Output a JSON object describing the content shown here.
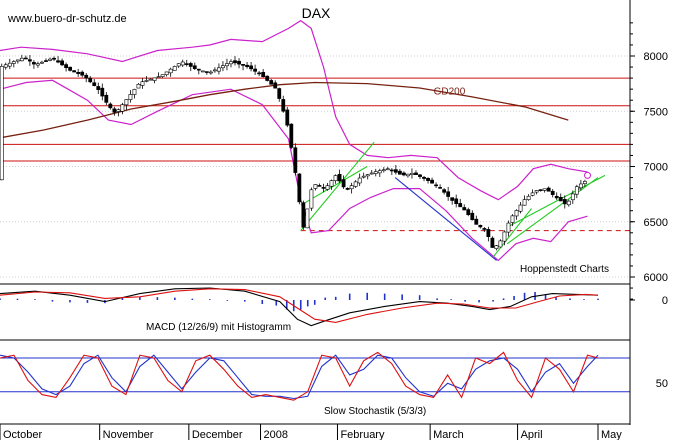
{
  "chart_data": [
    {
      "type": "candlestick",
      "panel": "price",
      "title": "DAX",
      "source_label": "www.buero-dr-schutz.de",
      "credit": "Hoppenstedt Charts",
      "y_ticks": [
        6000,
        6500,
        7000,
        7500,
        8000
      ],
      "ylim": [
        5800,
        8300
      ],
      "x_ticks": [
        "October",
        "November",
        "December",
        "2008",
        "February",
        "March",
        "April",
        "May"
      ],
      "moving_average": {
        "name": "GD200",
        "points": [
          [
            0,
            7260
          ],
          [
            25,
            7330
          ],
          [
            50,
            7420
          ],
          [
            75,
            7520
          ],
          [
            100,
            7590
          ],
          [
            120,
            7650
          ],
          [
            140,
            7700
          ],
          [
            160,
            7740
          ],
          [
            180,
            7760
          ],
          [
            210,
            7750
          ],
          [
            240,
            7710
          ],
          [
            270,
            7630
          ],
          [
            300,
            7540
          ],
          [
            325,
            7420
          ]
        ]
      },
      "price_path": [
        [
          0,
          7900
        ],
        [
          8,
          7950
        ],
        [
          14,
          7990
        ],
        [
          20,
          7920
        ],
        [
          30,
          7980
        ],
        [
          40,
          7870
        ],
        [
          48,
          7820
        ],
        [
          56,
          7700
        ],
        [
          62,
          7550
        ],
        [
          66,
          7480
        ],
        [
          70,
          7560
        ],
        [
          80,
          7760
        ],
        [
          92,
          7820
        ],
        [
          104,
          7950
        ],
        [
          112,
          7880
        ],
        [
          120,
          7850
        ],
        [
          132,
          7950
        ],
        [
          142,
          7900
        ],
        [
          150,
          7820
        ],
        [
          158,
          7700
        ],
        [
          164,
          7400
        ],
        [
          168,
          7050
        ],
        [
          171,
          6700
        ],
        [
          174,
          6400
        ],
        [
          177,
          6760
        ],
        [
          180,
          6840
        ],
        [
          186,
          6800
        ],
        [
          192,
          6920
        ],
        [
          198,
          6780
        ],
        [
          206,
          6900
        ],
        [
          214,
          6950
        ],
        [
          222,
          6980
        ],
        [
          230,
          6920
        ],
        [
          236,
          6940
        ],
        [
          244,
          6880
        ],
        [
          252,
          6800
        ],
        [
          258,
          6700
        ],
        [
          266,
          6600
        ],
        [
          272,
          6480
        ],
        [
          278,
          6420
        ],
        [
          282,
          6250
        ],
        [
          286,
          6320
        ],
        [
          292,
          6530
        ],
        [
          300,
          6700
        ],
        [
          306,
          6780
        ],
        [
          312,
          6800
        ],
        [
          318,
          6720
        ],
        [
          324,
          6650
        ],
        [
          330,
          6820
        ],
        [
          336,
          6880
        ]
      ],
      "upper_band": [
        [
          0,
          8050
        ],
        [
          12,
          8080
        ],
        [
          30,
          8060
        ],
        [
          50,
          8020
        ],
        [
          70,
          7950
        ],
        [
          90,
          8050
        ],
        [
          110,
          8080
        ],
        [
          120,
          8100
        ],
        [
          132,
          8150
        ],
        [
          150,
          8130
        ],
        [
          165,
          8250
        ],
        [
          172,
          8320
        ],
        [
          178,
          8250
        ],
        [
          185,
          7900
        ],
        [
          192,
          7450
        ],
        [
          200,
          7200
        ],
        [
          210,
          7100
        ],
        [
          222,
          7080
        ],
        [
          235,
          7100
        ],
        [
          250,
          7080
        ],
        [
          262,
          6900
        ],
        [
          275,
          6780
        ],
        [
          285,
          6700
        ],
        [
          296,
          6820
        ],
        [
          305,
          6980
        ],
        [
          315,
          7020
        ],
        [
          325,
          6980
        ],
        [
          336,
          6950
        ]
      ],
      "lower_band": [
        [
          0,
          7700
        ],
        [
          15,
          7760
        ],
        [
          30,
          7780
        ],
        [
          50,
          7600
        ],
        [
          62,
          7420
        ],
        [
          75,
          7380
        ],
        [
          90,
          7500
        ],
        [
          110,
          7650
        ],
        [
          132,
          7700
        ],
        [
          150,
          7560
        ],
        [
          165,
          7250
        ],
        [
          172,
          6700
        ],
        [
          178,
          6400
        ],
        [
          188,
          6420
        ],
        [
          200,
          6620
        ],
        [
          212,
          6720
        ],
        [
          225,
          6800
        ],
        [
          240,
          6800
        ],
        [
          255,
          6600
        ],
        [
          270,
          6350
        ],
        [
          285,
          6150
        ],
        [
          295,
          6300
        ],
        [
          305,
          6350
        ],
        [
          315,
          6320
        ],
        [
          325,
          6500
        ],
        [
          336,
          6550
        ]
      ],
      "horizontal_levels": [
        7800,
        7550,
        7200,
        7050
      ],
      "dashed_level": 6420,
      "trend_lines": [
        {
          "color": "#22cc22",
          "points": [
            [
              172,
              6420
            ],
            [
              214,
              7220
            ]
          ]
        },
        {
          "color": "#22cc22",
          "points": [
            [
              172,
              6650
            ],
            [
              210,
              7000
            ]
          ]
        },
        {
          "color": "#2233cc",
          "points": [
            [
              226,
              6900
            ],
            [
              284,
              6150
            ]
          ]
        },
        {
          "color": "#22cc22",
          "points": [
            [
              282,
              6180
            ],
            [
              304,
              6620
            ]
          ]
        },
        {
          "color": "#22cc22",
          "points": [
            [
              290,
              6300
            ],
            [
              342,
              6900
            ]
          ]
        },
        {
          "color": "#22cc22",
          "points": [
            [
              290,
              6450
            ],
            [
              346,
              6920
            ]
          ]
        }
      ]
    },
    {
      "type": "line",
      "panel": "macd",
      "label": "MACD (12/26/9) mit Histogramm",
      "y_ticks": [
        0
      ],
      "ylim": [
        -200,
        120
      ],
      "macd_line": [
        [
          0,
          40
        ],
        [
          20,
          55
        ],
        [
          40,
          30
        ],
        [
          60,
          -10
        ],
        [
          80,
          40
        ],
        [
          100,
          70
        ],
        [
          120,
          75
        ],
        [
          140,
          55
        ],
        [
          160,
          -10
        ],
        [
          170,
          -120
        ],
        [
          178,
          -160
        ],
        [
          186,
          -130
        ],
        [
          200,
          -80
        ],
        [
          220,
          -40
        ],
        [
          240,
          -10
        ],
        [
          256,
          -20
        ],
        [
          270,
          -40
        ],
        [
          280,
          -60
        ],
        [
          292,
          -40
        ],
        [
          304,
          20
        ],
        [
          316,
          40
        ],
        [
          330,
          35
        ],
        [
          342,
          30
        ]
      ],
      "signal_line": [
        [
          0,
          30
        ],
        [
          20,
          50
        ],
        [
          40,
          45
        ],
        [
          60,
          10
        ],
        [
          80,
          20
        ],
        [
          100,
          55
        ],
        [
          120,
          70
        ],
        [
          140,
          65
        ],
        [
          160,
          20
        ],
        [
          170,
          -50
        ],
        [
          180,
          -120
        ],
        [
          192,
          -140
        ],
        [
          210,
          -90
        ],
        [
          230,
          -50
        ],
        [
          250,
          -20
        ],
        [
          265,
          -25
        ],
        [
          280,
          -50
        ],
        [
          295,
          -50
        ],
        [
          308,
          -10
        ],
        [
          320,
          25
        ],
        [
          335,
          35
        ],
        [
          342,
          30
        ]
      ],
      "histogram": [
        [
          0,
          10
        ],
        [
          10,
          8
        ],
        [
          20,
          5
        ],
        [
          30,
          -10
        ],
        [
          40,
          -15
        ],
        [
          50,
          -18
        ],
        [
          60,
          -20
        ],
        [
          70,
          15
        ],
        [
          80,
          20
        ],
        [
          90,
          18
        ],
        [
          100,
          15
        ],
        [
          110,
          8
        ],
        [
          120,
          5
        ],
        [
          130,
          -5
        ],
        [
          140,
          -10
        ],
        [
          150,
          -25
        ],
        [
          158,
          -35
        ],
        [
          164,
          -60
        ],
        [
          168,
          -70
        ],
        [
          172,
          -60
        ],
        [
          176,
          -40
        ],
        [
          180,
          -30
        ],
        [
          186,
          15
        ],
        [
          192,
          20
        ],
        [
          200,
          40
        ],
        [
          210,
          45
        ],
        [
          220,
          40
        ],
        [
          230,
          35
        ],
        [
          240,
          30
        ],
        [
          250,
          10
        ],
        [
          258,
          5
        ],
        [
          266,
          -10
        ],
        [
          274,
          -15
        ],
        [
          282,
          -10
        ],
        [
          288,
          10
        ],
        [
          294,
          25
        ],
        [
          300,
          45
        ],
        [
          306,
          50
        ],
        [
          312,
          35
        ],
        [
          318,
          20
        ],
        [
          326,
          10
        ],
        [
          334,
          5
        ],
        [
          342,
          8
        ]
      ]
    },
    {
      "type": "line",
      "panel": "stochastic",
      "label": "Slow Stochastik (5/3/3)",
      "y_ticks": [
        50
      ],
      "ylim": [
        0,
        100
      ],
      "k_line": [
        [
          0,
          80
        ],
        [
          8,
          85
        ],
        [
          16,
          40
        ],
        [
          24,
          15
        ],
        [
          32,
          10
        ],
        [
          40,
          45
        ],
        [
          48,
          85
        ],
        [
          56,
          80
        ],
        [
          64,
          30
        ],
        [
          72,
          15
        ],
        [
          80,
          85
        ],
        [
          88,
          80
        ],
        [
          96,
          40
        ],
        [
          104,
          20
        ],
        [
          112,
          75
        ],
        [
          120,
          85
        ],
        [
          128,
          60
        ],
        [
          136,
          30
        ],
        [
          144,
          10
        ],
        [
          152,
          15
        ],
        [
          160,
          10
        ],
        [
          168,
          5
        ],
        [
          176,
          20
        ],
        [
          184,
          85
        ],
        [
          192,
          80
        ],
        [
          200,
          30
        ],
        [
          208,
          75
        ],
        [
          216,
          90
        ],
        [
          224,
          70
        ],
        [
          232,
          30
        ],
        [
          240,
          15
        ],
        [
          248,
          10
        ],
        [
          256,
          50
        ],
        [
          264,
          10
        ],
        [
          272,
          80
        ],
        [
          280,
          70
        ],
        [
          288,
          90
        ],
        [
          296,
          40
        ],
        [
          304,
          10
        ],
        [
          312,
          80
        ],
        [
          320,
          60
        ],
        [
          328,
          20
        ],
        [
          336,
          85
        ],
        [
          342,
          80
        ]
      ],
      "d_line": [
        [
          0,
          85
        ],
        [
          8,
          80
        ],
        [
          16,
          55
        ],
        [
          24,
          25
        ],
        [
          32,
          15
        ],
        [
          40,
          30
        ],
        [
          48,
          70
        ],
        [
          56,
          85
        ],
        [
          64,
          45
        ],
        [
          72,
          20
        ],
        [
          80,
          65
        ],
        [
          88,
          85
        ],
        [
          96,
          55
        ],
        [
          104,
          25
        ],
        [
          112,
          55
        ],
        [
          120,
          80
        ],
        [
          128,
          75
        ],
        [
          136,
          45
        ],
        [
          144,
          15
        ],
        [
          152,
          12
        ],
        [
          160,
          12
        ],
        [
          168,
          8
        ],
        [
          176,
          12
        ],
        [
          184,
          65
        ],
        [
          192,
          85
        ],
        [
          200,
          50
        ],
        [
          208,
          60
        ],
        [
          216,
          85
        ],
        [
          224,
          80
        ],
        [
          232,
          45
        ],
        [
          240,
          20
        ],
        [
          248,
          12
        ],
        [
          256,
          35
        ],
        [
          264,
          25
        ],
        [
          272,
          60
        ],
        [
          280,
          75
        ],
        [
          288,
          80
        ],
        [
          296,
          60
        ],
        [
          304,
          20
        ],
        [
          312,
          55
        ],
        [
          320,
          70
        ],
        [
          328,
          35
        ],
        [
          336,
          65
        ],
        [
          342,
          85
        ]
      ],
      "upper_level": 80,
      "lower_level": 20
    }
  ]
}
